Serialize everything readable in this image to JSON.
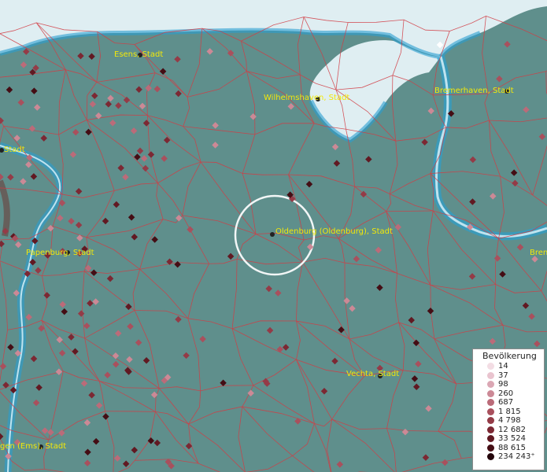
{
  "cities": [
    {
      "name": "Esens, Stadt"
    },
    {
      "name": "Wilhelmshaven, Stadt"
    },
    {
      "name": "Bremerhaven, Stadt"
    },
    {
      "name": "Stadt"
    },
    {
      "name": "Oldenburg (Oldenburg), Stadt"
    },
    {
      "name": "Papenburg, Stadt"
    },
    {
      "name": "Bren"
    },
    {
      "name": "Vechta, Stadt"
    },
    {
      "name": "gen (Ems), Stadt"
    }
  ],
  "legend": {
    "title": "Bevölkerung",
    "classes": [
      {
        "label": "14",
        "color": "#f3dde4"
      },
      {
        "label": "37",
        "color": "#e9c4cf"
      },
      {
        "label": "98",
        "color": "#dba7b4"
      },
      {
        "label": "260",
        "color": "#cc8996"
      },
      {
        "label": "687",
        "color": "#bb6b79"
      },
      {
        "label": "1 815",
        "color": "#a9505d"
      },
      {
        "label": "4 798",
        "color": "#943b47"
      },
      {
        "label": "12 682",
        "color": "#7c2833"
      },
      {
        "label": "33 524",
        "color": "#611922"
      },
      {
        "label": "88 615",
        "color": "#440d14"
      },
      {
        "label": "234 243⁺",
        "color": "#23040a"
      }
    ]
  },
  "colors": {
    "land": "#5f8f8c",
    "sea": "#dfeef2",
    "water_edge": "#2a9fd0",
    "borders": "#d23c44",
    "label": "#f2e80a",
    "focus_ring": "#f2f6f6"
  }
}
